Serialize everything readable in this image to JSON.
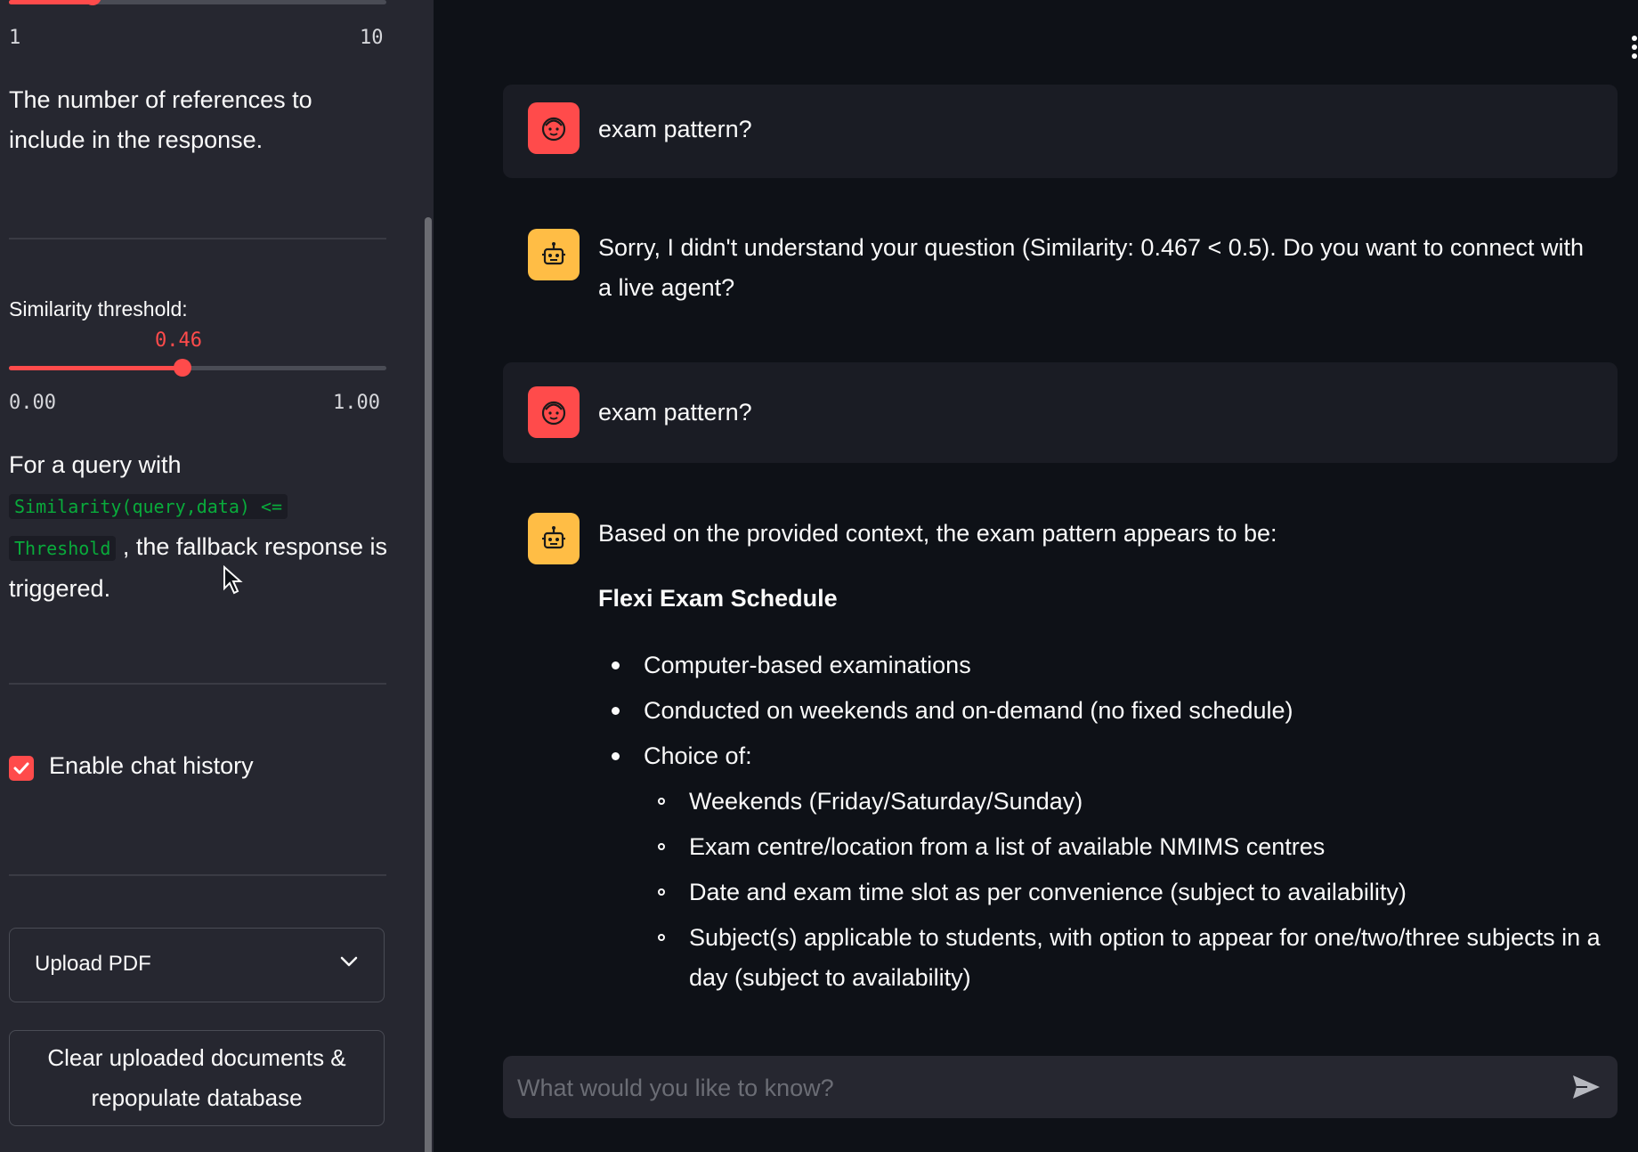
{
  "sidebar": {
    "references_slider": {
      "min": "1",
      "max": "10",
      "fraction": 0.11
    },
    "references_help": "The number of references to include in the response.",
    "similarity": {
      "label": "Similarity threshold:",
      "value": "0.46",
      "min": "0.00",
      "max": "1.00",
      "fraction": 0.46
    },
    "fallback_help": {
      "prefix": "For a query with",
      "code1": "Similarity(query,data) <=",
      "code2": "Threshold",
      "suffix": ", the fallback response is",
      "end": "triggered."
    },
    "chat_history": {
      "label": "Enable chat history",
      "checked": true
    },
    "upload": {
      "label": "Upload PDF"
    },
    "clear_button": {
      "line1": "Clear uploaded documents &",
      "line2": "repopulate database"
    }
  },
  "chat": {
    "messages": [
      {
        "role": "user",
        "icon": "user-face-icon",
        "text": "exam pattern?"
      },
      {
        "role": "assistant",
        "icon": "robot-icon",
        "text": "Sorry, I didn't understand your question (Similarity: 0.467 < 0.5). Do you want to connect with a live agent?"
      },
      {
        "role": "user",
        "icon": "user-face-icon",
        "text": "exam pattern?"
      },
      {
        "role": "assistant",
        "icon": "robot-icon",
        "intro": "Based on the provided context, the exam pattern appears to be:",
        "heading": "Flexi Exam Schedule",
        "bullets": [
          "Computer-based examinations",
          "Conducted on weekends and on-demand (no fixed schedule)",
          "Choice of:"
        ],
        "sub_bullets": [
          "Weekends (Friday/Saturday/Sunday)",
          "Exam centre/location from a list of available NMIMS centres",
          "Date and exam time slot as per convenience (subject to availability)",
          "Subject(s) applicable to students, with option to appear for one/two/three subjects in a",
          "day (subject to availability)"
        ]
      }
    ],
    "input": {
      "placeholder": "What would you like to know?"
    }
  },
  "colors": {
    "accent": "#ff4b4b",
    "bot_avatar": "#ffbd45",
    "background": "#0e1117",
    "sidebar": "#262730"
  }
}
